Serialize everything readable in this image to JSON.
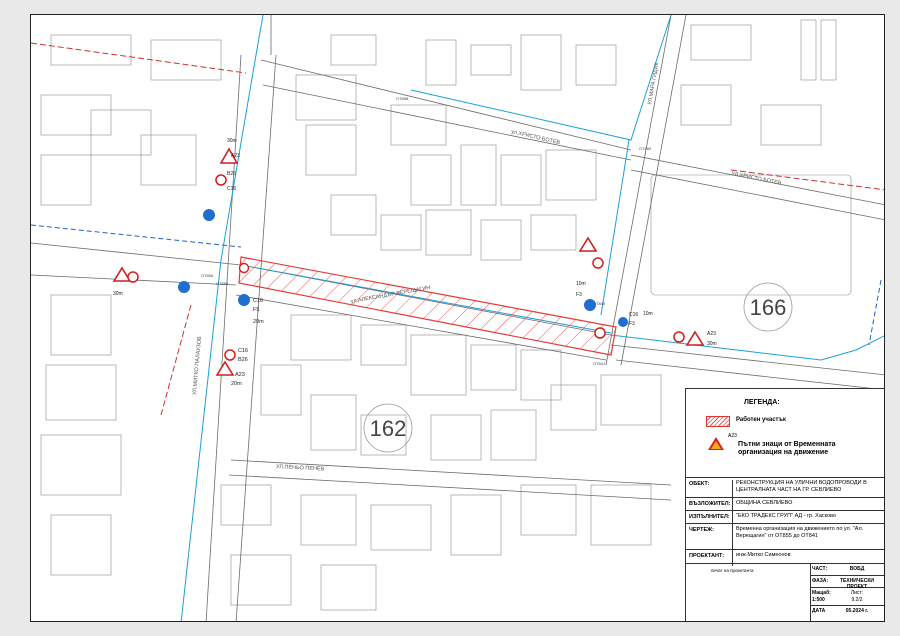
{
  "map": {
    "blocks": [
      "162",
      "166"
    ],
    "streets": {
      "hristo_botev_a": "ул.ХРИСТО БОТЕВ",
      "hristo_botev_b": "УЛ.ХРИСТО БОТЕВ",
      "aleksandar_vereshchagin": "ул.АЛЕКСАНДЪР ВЕРЕЩАГИН",
      "penyo_penev": "УЛ.ПЕНЬО ПЕНЕВ",
      "mara_gidik": "УЛ.МАРА ГИДИК",
      "mitko_palauzov": "УЛ.МИТКО ПАЛАУЗОВ"
    },
    "signs": {
      "a23": "A23",
      "c16": "C16",
      "b26": "B26",
      "f5": "F5",
      "f3": "F3",
      "dist_10": "10m",
      "dist_20": "20m",
      "dist_30": "30m"
    },
    "street_codes": {
      "ot855": "OT855",
      "ot856": "OT856",
      "ot858": "OT858",
      "ot841": "OT841",
      "ot843": "OT843",
      "ot859": "OT859"
    },
    "colors": {
      "work_zone": "#e33b3b",
      "water_line": "#1aa0d8",
      "sign_red": "#d21f1f",
      "sign_blue": "#1e6fd0",
      "redline": "#d03030"
    }
  },
  "legend": {
    "title": "ЛЕГЕНДА:",
    "work_area": "Работен участък",
    "sign_code": "A23",
    "signs_label": "Пътни знаци от Временната организация на движение"
  },
  "title_block": {
    "object_label": "ОБЕКТ:",
    "object_value": "РЕКОНСТРУКЦИЯ НА УЛИЧНИ ВОДОПРОВОДИ В ЦЕНТРАЛНАТА ЧАСТ НА ГР. СЕВЛИЕВО",
    "client_label": "ВЪЗЛОЖИТЕЛ:",
    "client_value": "ОБЩИНА СЕВЛИЕВО",
    "contractor_label": "ИЗПЪЛНИТЕЛ:",
    "contractor_value": "\"ЕКО ТРАДЕКС ГРУП\" АД - гр. Хасково",
    "drawing_label": "ЧЕРТЕЖ:",
    "drawing_value": "Временна организация на движението по ул. \"Ал. Верещагин\" от ОТ855 до ОТ841",
    "designer_label": "ПРОЕКТАНТ:",
    "designer_value": "инж.Митко Симеонов",
    "stamp_label": "печат на проектанта",
    "part_label": "ЧАСТ:",
    "part_value": "ВОБД",
    "phase_label": "ФАЗА:",
    "phase_value": "ТЕХНИЧЕСКИ ПРОЕКТ",
    "scale_label": "Мащаб:",
    "scale_value": "1:500",
    "sheet_label": "Лист:",
    "sheet_value": "9.2/2",
    "date_label": "ДАТА",
    "date_value": "05.2024 г."
  }
}
